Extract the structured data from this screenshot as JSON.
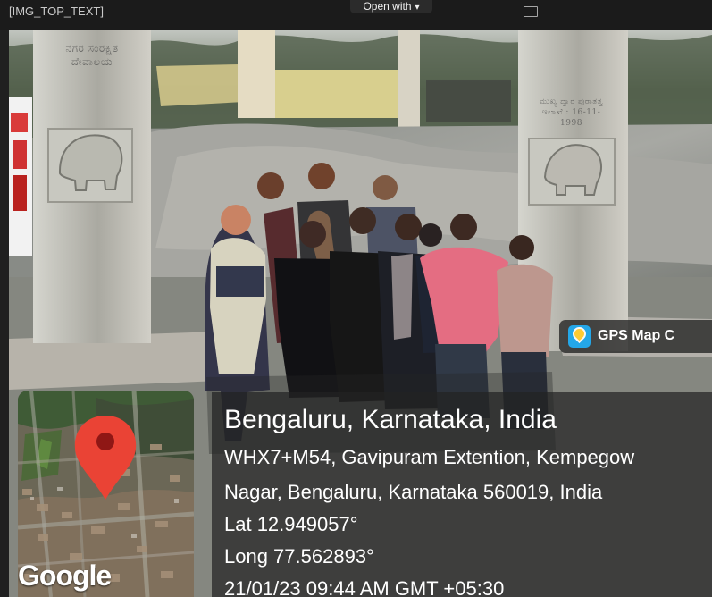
{
  "viewer": {
    "filename_text": "[IMG_TOP_TEXT]",
    "open_with_label": "Open with",
    "caret": "▾"
  },
  "photo": {
    "left_pillar_inscription": "ನಗರ ಸಂರಕ್ಷಿತ ದೇವಾಲಯ",
    "right_pillar_inscription": "ಮುಖ್ಯ ದ್ವಾರ ಪುರಾತತ್ವ ಇಲಾಖೆ : 16-11-1998"
  },
  "gps_badge": {
    "label": "GPS Map C",
    "icon": "gps-map-icon",
    "icon_color": "#24a7e8"
  },
  "location": {
    "title": "Bengaluru, Karnataka, India",
    "address_line_1": "WHX7+M54, Gavipuram Extention, Kempegow",
    "address_line_2": "Nagar, Bengaluru, Karnataka 560019, India",
    "latitude": "Lat 12.949057°",
    "longitude": "Long 77.562893°",
    "timestamp": "21/01/23 09:44 AM GMT +05:30"
  },
  "map": {
    "brand": "Google",
    "pin_icon": "location-pin-icon",
    "pin_color": "#ea4335"
  }
}
